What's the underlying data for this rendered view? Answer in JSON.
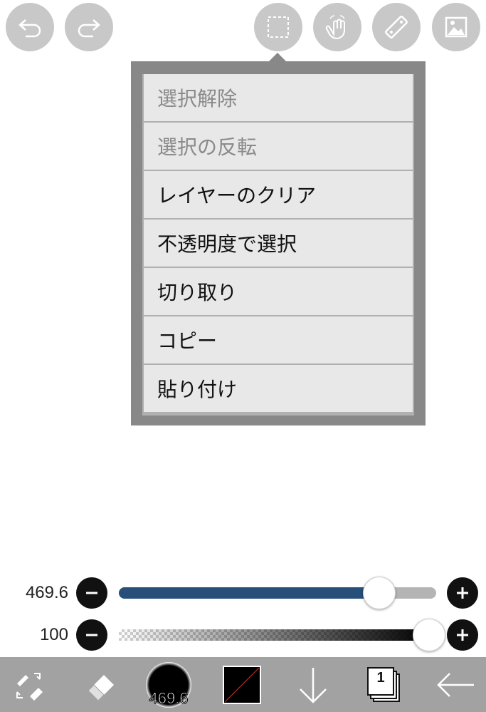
{
  "top_toolbar": {
    "undo_icon": "undo-icon",
    "redo_icon": "redo-icon",
    "selection_icon": "selection-icon",
    "touch_icon": "hand-touch-icon",
    "ruler_icon": "ruler-icon",
    "material_icon": "image-icon"
  },
  "selection_menu": {
    "items": [
      {
        "label": "選択解除",
        "enabled": false
      },
      {
        "label": "選択の反転",
        "enabled": false
      },
      {
        "label": "レイヤーのクリア",
        "enabled": true
      },
      {
        "label": "不透明度で選択",
        "enabled": true
      },
      {
        "label": "切り取り",
        "enabled": true
      },
      {
        "label": "コピー",
        "enabled": true
      },
      {
        "label": "貼り付け",
        "enabled": true
      }
    ]
  },
  "sliders": {
    "brush_size": {
      "value": "469.6",
      "fill_fraction": 0.82,
      "color": "#274f7a"
    },
    "opacity": {
      "value": "100",
      "fill_fraction": 1.0
    }
  },
  "bottom_toolbar": {
    "brush_size_label": "469.6",
    "layer_count": "1",
    "color": "#000000"
  }
}
